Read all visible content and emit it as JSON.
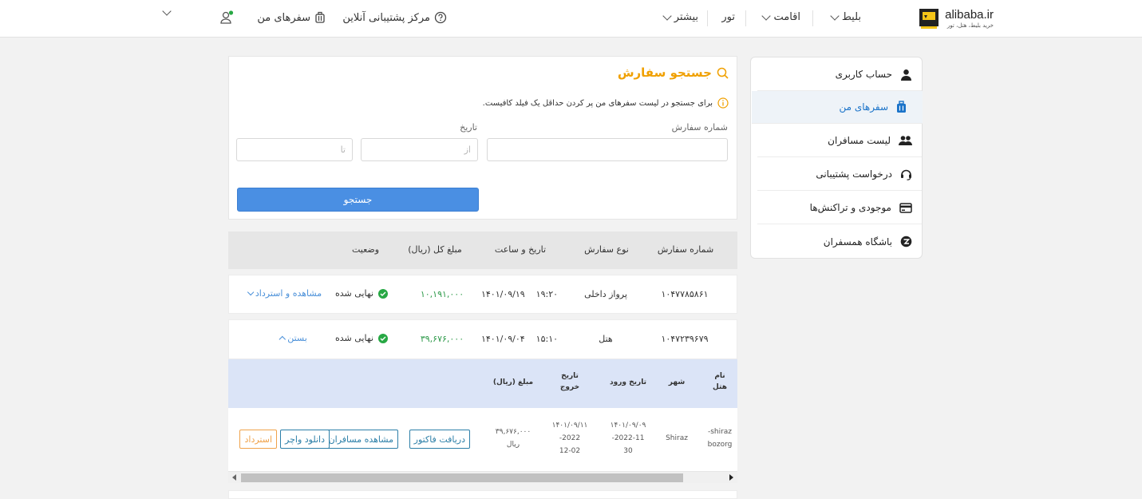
{
  "nav": {
    "logo_brand": "alibaba.ir",
    "logo_tagline": "خرید بلیط، هتل، تور",
    "ticket": "بلیط",
    "stay": "اقامت",
    "tour": "تور",
    "more": "بیشتر",
    "support": "مرکز پشتیبانی آنلاین",
    "my_trips": "سفرهای من"
  },
  "sidebar": {
    "items": [
      {
        "label": "حساب کاربری",
        "icon": "user-icon"
      },
      {
        "label": "سفرهای من",
        "icon": "suitcase-icon"
      },
      {
        "label": "لیست مسافران",
        "icon": "users-icon"
      },
      {
        "label": "درخواست پشتیبانی",
        "icon": "headset-icon"
      },
      {
        "label": "موجودی و تراکنش‌ها",
        "icon": "card-icon"
      },
      {
        "label": "باشگاه همسفران",
        "icon": "club-icon"
      }
    ]
  },
  "search": {
    "title": "جستجو سفارش",
    "hint": "برای جستجو در لیست سفرهای من پر کردن حداقل یک فیلد کافیست.",
    "order_label": "شماره سفارش",
    "date_label": "تاریخ",
    "from_placeholder": "از",
    "to_placeholder": "تا",
    "button": "جستجو"
  },
  "orders": {
    "headers": [
      "شماره سفارش",
      "نوع سفارش",
      "تاریخ و ساعت",
      "مبلغ کل (ریال)",
      "وضعیت"
    ],
    "rows": [
      {
        "number": "۱۰۴۷۷۸۵۸۶۱",
        "type": "پرواز داخلی",
        "date": "۱۴۰۱/۰۹/۱۹",
        "time": "۱۹:۲۰",
        "amount": "۱۰,۱۹۱,۰۰۰",
        "status": "نهایی شده",
        "action": "مشاهده و استرداد"
      },
      {
        "number": "۱۰۴۷۲۳۹۶۷۹",
        "type": "هتل",
        "date": "۱۴۰۱/۰۹/۰۴",
        "time": "۱۵:۱۰",
        "amount": "۳۹,۶۷۶,۰۰۰",
        "status": "نهایی شده",
        "action": "بستن"
      }
    ]
  },
  "details": {
    "headers": {
      "hotel_name_1": "نام",
      "hotel_name_2": "هتل",
      "city": "شهر",
      "checkin": "تاریخ ورود",
      "checkout_1": "تاریخ",
      "checkout_2": "خروج",
      "amount": "مبلغ (ریال)"
    },
    "row": {
      "hotel_1": "shiraz-",
      "hotel_2": "bozorg",
      "city": "Shiraz",
      "checkin_fa": "۱۴۰۱/۰۹/۰۹",
      "checkin_en_1": "2022-11-",
      "checkin_en_2": "30",
      "checkout_fa": "۱۴۰۱/۰۹/۱۱",
      "checkout_en_1": "2022-",
      "checkout_en_2": "12-02",
      "amount": "۳۹,۶۷۶,۰۰۰",
      "currency": "ریال",
      "btn_invoice": "دریافت فاکتور",
      "btn_passengers": "مشاهده مسافران",
      "btn_voucher": "دانلود واچر",
      "btn_refund": "استرداد"
    }
  },
  "colors": {
    "accent_blue": "#4a8fe3",
    "title_orange": "#f0a000",
    "success_green": "#27a844"
  }
}
